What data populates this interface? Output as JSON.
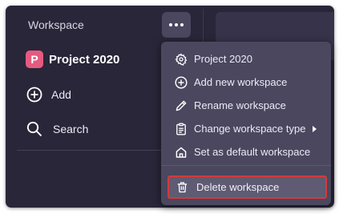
{
  "sidebar": {
    "workspace_label": "Workspace",
    "more_icon": "more-horizontal-icon",
    "project": {
      "avatar_letter": "P",
      "name": "Project 2020",
      "avatar_color": "#e55a7f"
    },
    "add_label": "Add",
    "search_label": "Search"
  },
  "menu": {
    "items": [
      {
        "label": "Project 2020",
        "icon": "gear-icon"
      },
      {
        "label": "Add new workspace",
        "icon": "plus-circle-icon"
      },
      {
        "label": "Rename workspace",
        "icon": "pencil-icon"
      },
      {
        "label": "Change workspace type",
        "icon": "clipboard-icon",
        "has_submenu": true
      },
      {
        "label": "Set as default workspace",
        "icon": "home-icon"
      }
    ],
    "delete": {
      "label": "Delete workspace",
      "icon": "trash-icon",
      "highlight_color": "#d23b3b"
    }
  },
  "colors": {
    "background": "#292639",
    "menu": "#4a475f",
    "accent_project": "#e55a7f"
  }
}
